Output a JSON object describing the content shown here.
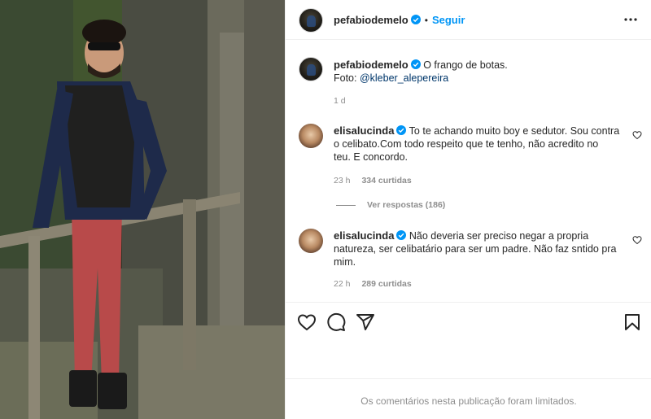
{
  "owner": {
    "username": "pefabiodemelo",
    "follow_label": "Seguir",
    "separator": "•"
  },
  "caption": {
    "username": "pefabiodemelo",
    "text": "O frango de botas.",
    "photo_credit_prefix": "Foto: ",
    "photo_credit_mention": "@kleber_alepereira",
    "age": "1 d"
  },
  "comments": [
    {
      "username": "elisalucinda",
      "text_line1": "To te achando muito boy e sedutor. Sou contra",
      "text_line2": "o celibato.Com todo respeito que te tenho, não acredito no",
      "text_line3": "teu. E concordo.",
      "age": "23 h",
      "likes": "334 curtidas",
      "view_replies": "Ver respostas (186)"
    },
    {
      "username": "elisalucinda",
      "text_line1": "Não deveria ser preciso negar a propria",
      "text_line2": "natureza, ser celibatário para ser um padre. Não faz sntido pra",
      "text_line3": "mim.",
      "age": "22 h",
      "likes": "289 curtidas"
    }
  ],
  "footer": {
    "limited_notice": "Os comentários nesta publicação foram limitados."
  },
  "icons": {
    "verified": "verified-badge-icon",
    "more": "more-options-icon",
    "like": "heart-icon",
    "comment": "comment-icon",
    "share": "paper-plane-icon",
    "save": "bookmark-icon"
  },
  "colors": {
    "accent": "#0095f6",
    "muted": "#8e8e8e",
    "text": "#262626",
    "mention": "#00376b"
  }
}
